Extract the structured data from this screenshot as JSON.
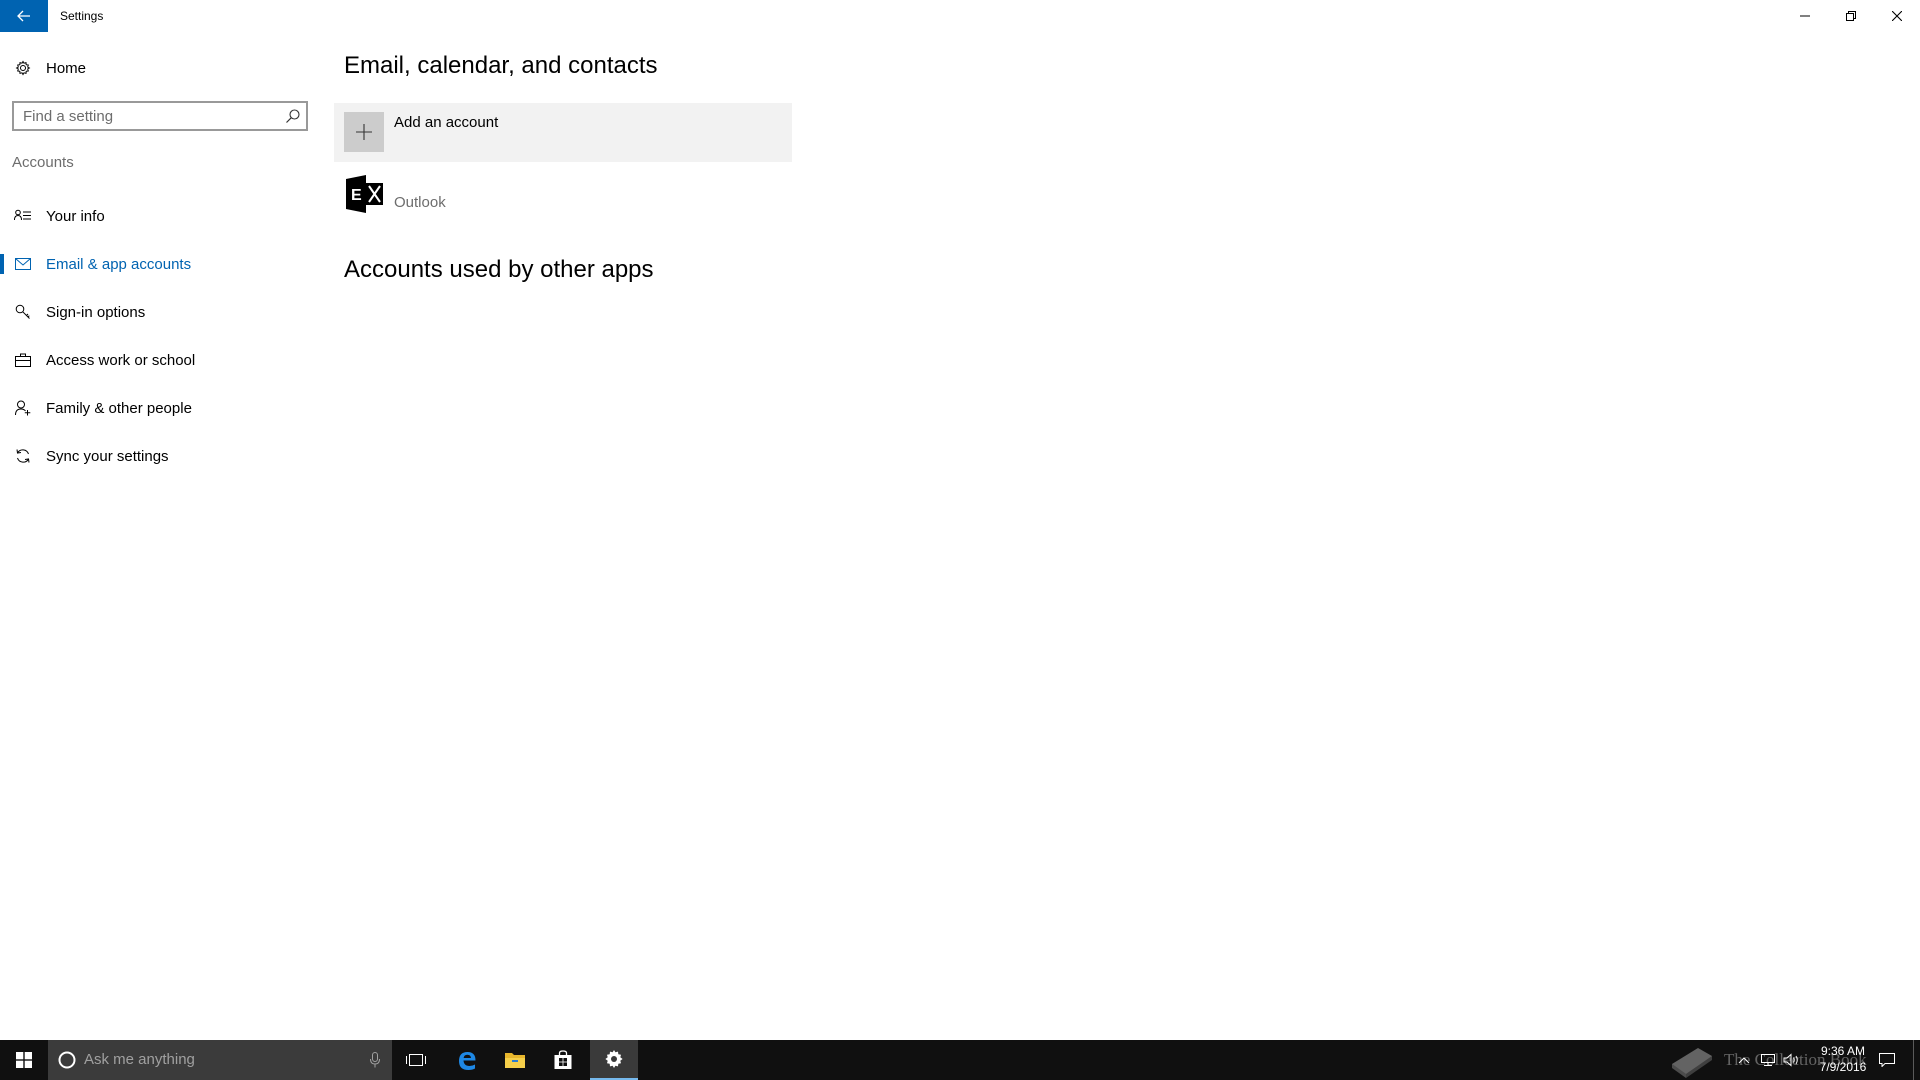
{
  "window": {
    "title": "Settings",
    "back_icon": "back-arrow-icon"
  },
  "sidebar": {
    "home_label": "Home",
    "search_placeholder": "Find a setting",
    "search_value": "",
    "section_label": "Accounts",
    "items": [
      {
        "label": "Your info",
        "icon": "contact-info-icon",
        "selected": false
      },
      {
        "label": "Email & app accounts",
        "icon": "mail-icon",
        "selected": true
      },
      {
        "label": "Sign-in options",
        "icon": "key-icon",
        "selected": false
      },
      {
        "label": "Access work or school",
        "icon": "briefcase-icon",
        "selected": false
      },
      {
        "label": "Family & other people",
        "icon": "add-person-icon",
        "selected": false
      },
      {
        "label": "Sync your settings",
        "icon": "sync-icon",
        "selected": false
      }
    ]
  },
  "main": {
    "section1_title": "Email, calendar, and contacts",
    "add_account_label": "Add an account",
    "accounts": [
      {
        "name": "Outlook",
        "icon": "exchange-icon"
      }
    ],
    "section2_title": "Accounts used by other apps"
  },
  "taskbar": {
    "search_placeholder": "Ask me anything",
    "time": "9:36 AM",
    "date": "7/9/2016"
  },
  "watermark": {
    "text": "The Collection Book"
  },
  "colors": {
    "accent": "#0063b1",
    "taskbar_bg": "#101010",
    "tile_gray": "#cccccc",
    "hover_bg": "#f2f2f2"
  }
}
